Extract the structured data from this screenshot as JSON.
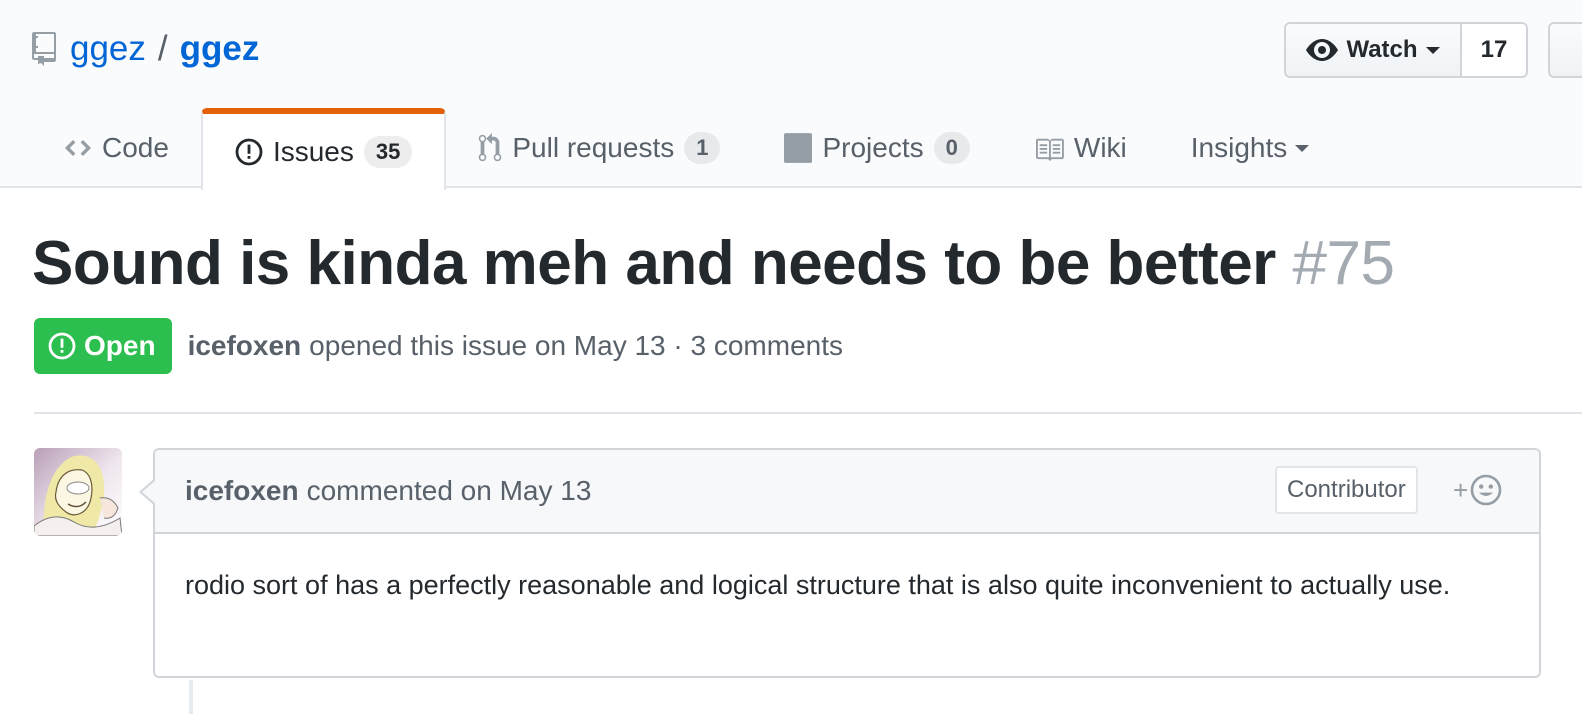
{
  "repo": {
    "owner": "ggez",
    "separator": "/",
    "name": "ggez",
    "icon": "repo-icon"
  },
  "watch": {
    "label": "Watch",
    "count": "17"
  },
  "tabs": [
    {
      "label": "Code",
      "icon": "code-icon",
      "counter": null,
      "selected": false
    },
    {
      "label": "Issues",
      "icon": "issue-opened-icon",
      "counter": "35",
      "selected": true
    },
    {
      "label": "Pull requests",
      "icon": "git-pull-request-icon",
      "counter": "1",
      "selected": false
    },
    {
      "label": "Projects",
      "icon": "project-icon",
      "counter": "0",
      "selected": false
    },
    {
      "label": "Wiki",
      "icon": "book-icon",
      "counter": null,
      "selected": false
    },
    {
      "label": "Insights",
      "icon": null,
      "counter": null,
      "selected": false
    }
  ],
  "issue": {
    "title": "Sound is kinda meh and needs to be better",
    "number": "#75",
    "state": "Open",
    "author": "icefoxen",
    "meta_text": "opened this issue on May 13 · 3 comments"
  },
  "comment": {
    "author": "icefoxen",
    "action_text": "commented on May 13",
    "role_badge": "Contributor",
    "reaction_label": "+",
    "body": "rodio sort of has a perfectly reasonable and logical structure that is also quite inconvenient to actually use."
  },
  "colors": {
    "link": "#0366d6",
    "open_state": "#2cbe4e",
    "selected_tab_accent": "#e36209",
    "issue_number": "#a3aab1"
  }
}
